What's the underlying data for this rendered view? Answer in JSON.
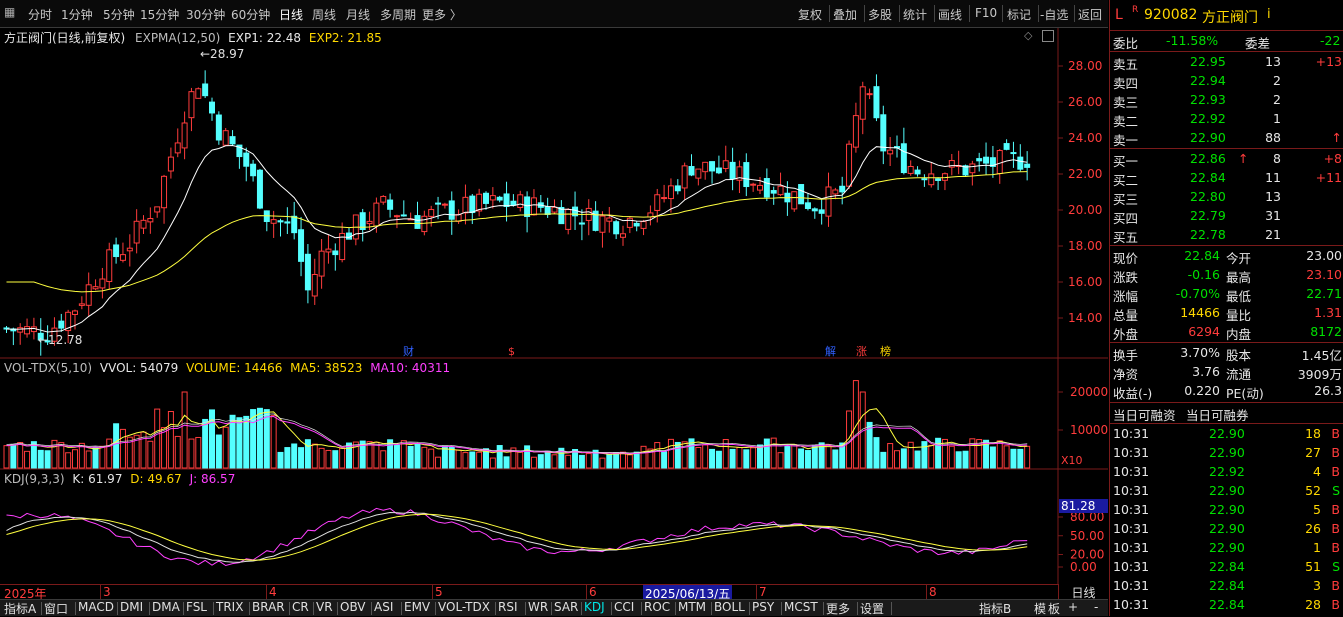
{
  "toolbar": {
    "periods": [
      "分时",
      "1分钟",
      "5分钟",
      "15分钟",
      "30分钟",
      "60分钟",
      "日线",
      "周线",
      "月线",
      "多周期",
      "更多 〉"
    ],
    "active": "日线",
    "right_buttons": [
      "复权",
      "叠加",
      "多股",
      "统计",
      "画线",
      "F10",
      "标记",
      "-自选",
      "返回"
    ]
  },
  "main_panel": {
    "title": "方正阀门(日线,前复权)",
    "indicator": "EXPMA(12,50)",
    "exp1": "EXP1: 22.48",
    "exp2": "EXP2: 21.85",
    "high_label": "28.97",
    "low_label": "12.78",
    "markers": [
      "财",
      "$",
      "解",
      "涨",
      "榜"
    ],
    "y_ticks": [
      "28.00",
      "26.00",
      "24.00",
      "22.00",
      "20.00",
      "18.00",
      "16.00",
      "14.00"
    ]
  },
  "vol_panel": {
    "title": "VOL-TDX(5,10)",
    "vvol": "VVOL: 54079",
    "volume": "VOLUME: 14466",
    "ma5": "MA5: 38523",
    "ma10": "MA10: 40311",
    "y_ticks": [
      "20000",
      "10000"
    ],
    "unit": "X10"
  },
  "kdj_panel": {
    "title": "KDJ(9,3,3)",
    "k": "K: 61.97",
    "d": "D: 49.67",
    "j": "J: 86.57",
    "y_ticks": [
      "80.00",
      "50.00",
      "20.00",
      "0.00"
    ],
    "current": "81.28"
  },
  "date_axis": {
    "labels": [
      "2025年",
      "3",
      "4",
      "5",
      "6",
      "2025/06/13/五",
      "7",
      "8"
    ],
    "period": "日线"
  },
  "bottom_tabs": [
    "指标A",
    "窗口",
    "MACD",
    "DMI",
    "DMA",
    "FSL",
    "TRIX",
    "BRAR",
    "CR",
    "VR",
    "OBV",
    "ASI",
    "EMV",
    "VOL-TDX",
    "RSI",
    "WR",
    "SAR",
    "KDJ",
    "CCI",
    "ROC",
    "MTM",
    "BOLL",
    "PSY",
    "MCST",
    "更多",
    "设置"
  ],
  "bottom_right": [
    "指标B",
    "模",
    "板",
    "+",
    "-"
  ],
  "quote": {
    "flag": "L",
    "r": "R",
    "code": "920082",
    "name": "方正阀门",
    "info": "i",
    "weibi_label": "委比",
    "weibi": "-11.58%",
    "weicha_label": "委差",
    "weicha": "-22",
    "asks": [
      {
        "label": "卖五",
        "price": "22.95",
        "vol": "13",
        "chg": "+13"
      },
      {
        "label": "卖四",
        "price": "22.94",
        "vol": "2",
        "chg": ""
      },
      {
        "label": "卖三",
        "price": "22.93",
        "vol": "2",
        "chg": ""
      },
      {
        "label": "卖二",
        "price": "22.92",
        "vol": "1",
        "chg": ""
      },
      {
        "label": "卖一",
        "price": "22.90",
        "vol": "88",
        "chg": "↑"
      }
    ],
    "bids": [
      {
        "label": "买一",
        "price": "22.86",
        "vol": "8",
        "chg": "+8",
        "arrow": "↑"
      },
      {
        "label": "买二",
        "price": "22.84",
        "vol": "11",
        "chg": "+11",
        "arrow": ""
      },
      {
        "label": "买三",
        "price": "22.80",
        "vol": "13",
        "chg": "",
        "arrow": ""
      },
      {
        "label": "买四",
        "price": "22.79",
        "vol": "31",
        "chg": "",
        "arrow": ""
      },
      {
        "label": "买五",
        "price": "22.78",
        "vol": "21",
        "chg": "",
        "arrow": ""
      }
    ],
    "stats": [
      {
        "l1": "现价",
        "v1": "22.84",
        "l2": "今开",
        "v2": "23.00"
      },
      {
        "l1": "涨跌",
        "v1": "-0.16",
        "l2": "最高",
        "v2": "23.10"
      },
      {
        "l1": "涨幅",
        "v1": "-0.70%",
        "l2": "最低",
        "v2": "22.71"
      },
      {
        "l1": "总量",
        "v1": "14466",
        "l2": "量比",
        "v2": "1.31"
      },
      {
        "l1": "外盘",
        "v1": "6294",
        "l2": "内盘",
        "v2": "8172"
      }
    ],
    "stats2": [
      {
        "l1": "换手",
        "v1": "3.70%",
        "l2": "股本",
        "v2": "1.45亿"
      },
      {
        "l1": "净资",
        "v1": "3.76",
        "l2": "流通",
        "v2": "3909万"
      },
      {
        "l1": "收益(-)",
        "v1": "0.220",
        "l2": "PE(动)",
        "v2": "26.3"
      }
    ],
    "tabs": [
      "当日可融资",
      "当日可融券"
    ],
    "trades": [
      {
        "t": "10:31",
        "p": "22.90",
        "v": "18",
        "s": "B"
      },
      {
        "t": "10:31",
        "p": "22.90",
        "v": "27",
        "s": "B"
      },
      {
        "t": "10:31",
        "p": "22.92",
        "v": "4",
        "s": "B"
      },
      {
        "t": "10:31",
        "p": "22.90",
        "v": "52",
        "s": "S"
      },
      {
        "t": "10:31",
        "p": "22.90",
        "v": "5",
        "s": "B"
      },
      {
        "t": "10:31",
        "p": "22.90",
        "v": "26",
        "s": "B"
      },
      {
        "t": "10:31",
        "p": "22.90",
        "v": "1",
        "s": "B"
      },
      {
        "t": "10:31",
        "p": "22.84",
        "v": "51",
        "s": "S"
      },
      {
        "t": "10:31",
        "p": "22.84",
        "v": "3",
        "s": "B"
      },
      {
        "t": "10:31",
        "p": "22.84",
        "v": "28",
        "s": "B"
      }
    ]
  }
}
